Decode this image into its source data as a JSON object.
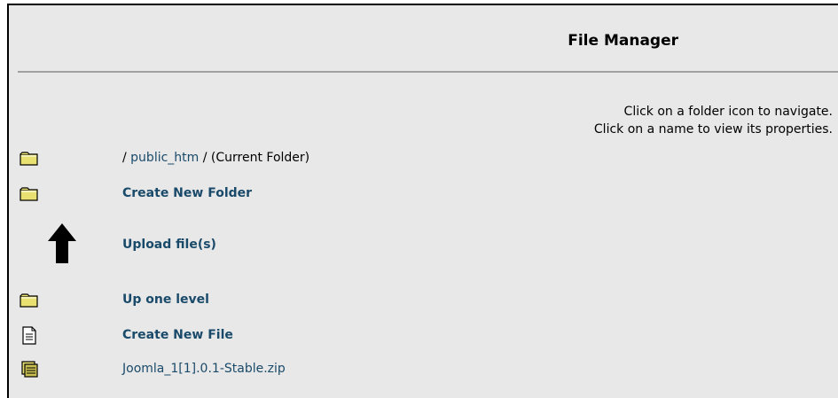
{
  "header": {
    "title": "File Manager"
  },
  "instructions": {
    "line1": "Click on a folder icon to navigate.",
    "line2": "Click on a name to view its properties."
  },
  "path": {
    "sep1": "/",
    "folder": "public_htm",
    "sep2": "/",
    "current": "(Current Folder)"
  },
  "actions": {
    "create_folder": "Create New Folder",
    "upload": "Upload file(s)",
    "up_level": "Up one level",
    "create_file": "Create New File"
  },
  "files": [
    {
      "name": "Joomla_1[1].0.1-Stable.zip",
      "icon": "zip-archive-icon"
    }
  ],
  "colors": {
    "link": "#1a4a6a",
    "panel_bg": "#e8e8e8",
    "folder_fill": "#e8e070"
  }
}
